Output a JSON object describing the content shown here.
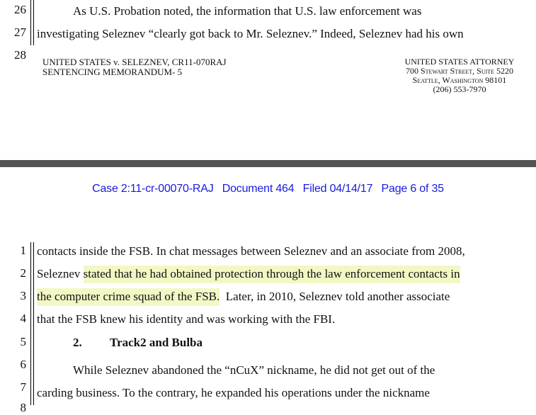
{
  "top_page": {
    "line_numbers": [
      "26",
      "27",
      "28"
    ],
    "lines": [
      "As U.S. Probation noted, the information that U.S. law enforcement was",
      "investigating Seleznev “clearly got back to Mr. Seleznev.”  Indeed, Seleznev had his own"
    ],
    "footer_left": [
      "UNITED STATES v. SELEZNEV, CR11-070RAJ",
      "SENTENCING MEMORANDUM- 5"
    ],
    "footer_right": [
      "UNITED STATES ATTORNEY",
      "700 Stewart Street, Suite 5220",
      "Seattle, Washington 98101",
      "(206) 553-7970"
    ]
  },
  "bottom_page": {
    "ecf_header": {
      "case": "Case 2:11-cr-00070-RAJ",
      "document": "Document 464",
      "filed": "Filed 04/14/17",
      "page": "Page 6 of 35"
    },
    "highlight_color": "#f3f7c4",
    "line_numbers": [
      "1",
      "2",
      "3",
      "4",
      "5",
      "6",
      "7",
      "8"
    ],
    "line1": "contacts inside the FSB.  In chat messages between Seleznev and an associate from 2008,",
    "line2_pre": "Seleznev ",
    "line2_hl": "stated that he had obtained protection through the law enforcement contacts in",
    "line3_hl": "the computer crime squad of the FSB.",
    "line3_post": "  Later, in 2010, Seleznev told another associate",
    "line4": "that the FSB knew his identity and was working with the FBI.",
    "heading_number": "2.",
    "heading_title": "Track2 and Bulba",
    "line6": "While Seleznev abandoned the “nCuX” nickname, he did not get out of the",
    "line7": "carding business.  To the contrary, he expanded his operations under the nickname"
  }
}
